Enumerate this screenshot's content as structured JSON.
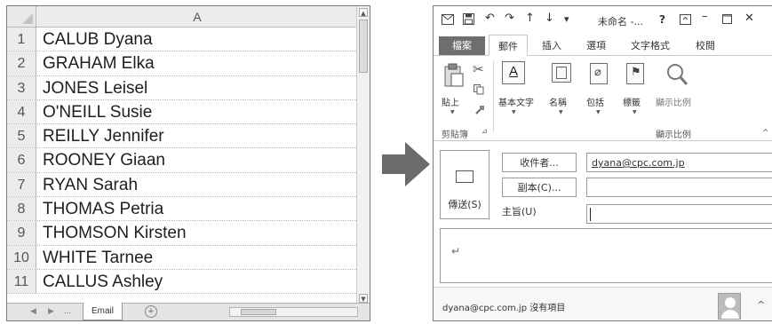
{
  "sheet": {
    "column_header": "A",
    "rows": [
      {
        "num": "1",
        "value": "CALUB Dyana"
      },
      {
        "num": "2",
        "value": "GRAHAM Elka"
      },
      {
        "num": "3",
        "value": "JONES Leisel"
      },
      {
        "num": "4",
        "value": "O'NEILL Susie"
      },
      {
        "num": "5",
        "value": "REILLY Jennifer"
      },
      {
        "num": "6",
        "value": "ROONEY Giaan"
      },
      {
        "num": "7",
        "value": "RYAN Sarah"
      },
      {
        "num": "8",
        "value": "THOMAS Petria"
      },
      {
        "num": "9",
        "value": "THOMSON Kirsten"
      },
      {
        "num": "10",
        "value": "WHITE Tarnee"
      },
      {
        "num": "11",
        "value": "CALLUS Ashley"
      }
    ],
    "tab_more": "...",
    "sheet_tab": "Email",
    "add_tab": "+"
  },
  "mail": {
    "window_title": "未命名 -...",
    "help": "?",
    "tabs": {
      "file": "檔案",
      "message": "郵件",
      "insert": "插入",
      "options": "選項",
      "format": "文字格式",
      "review": "校閱"
    },
    "ribbon": {
      "paste": "貼上",
      "basic_text": "基本文字",
      "names": "名稱",
      "include": "包括",
      "tags": "標籤",
      "zoom": "顯示比例",
      "clipboard_group": "剪貼簿",
      "zoom_group": "顯示比例"
    },
    "compose": {
      "send": "傳送(S)",
      "to_button": "收件者...",
      "cc_button": "副本(C)...",
      "subject_label": "主旨(U)",
      "to_value": "dyana@cpc.com.jp",
      "cc_value": "",
      "subject_value": "",
      "body_mark": "↵"
    },
    "people_pane": {
      "text": "dyana@cpc.com.jp 沒有項目"
    }
  }
}
